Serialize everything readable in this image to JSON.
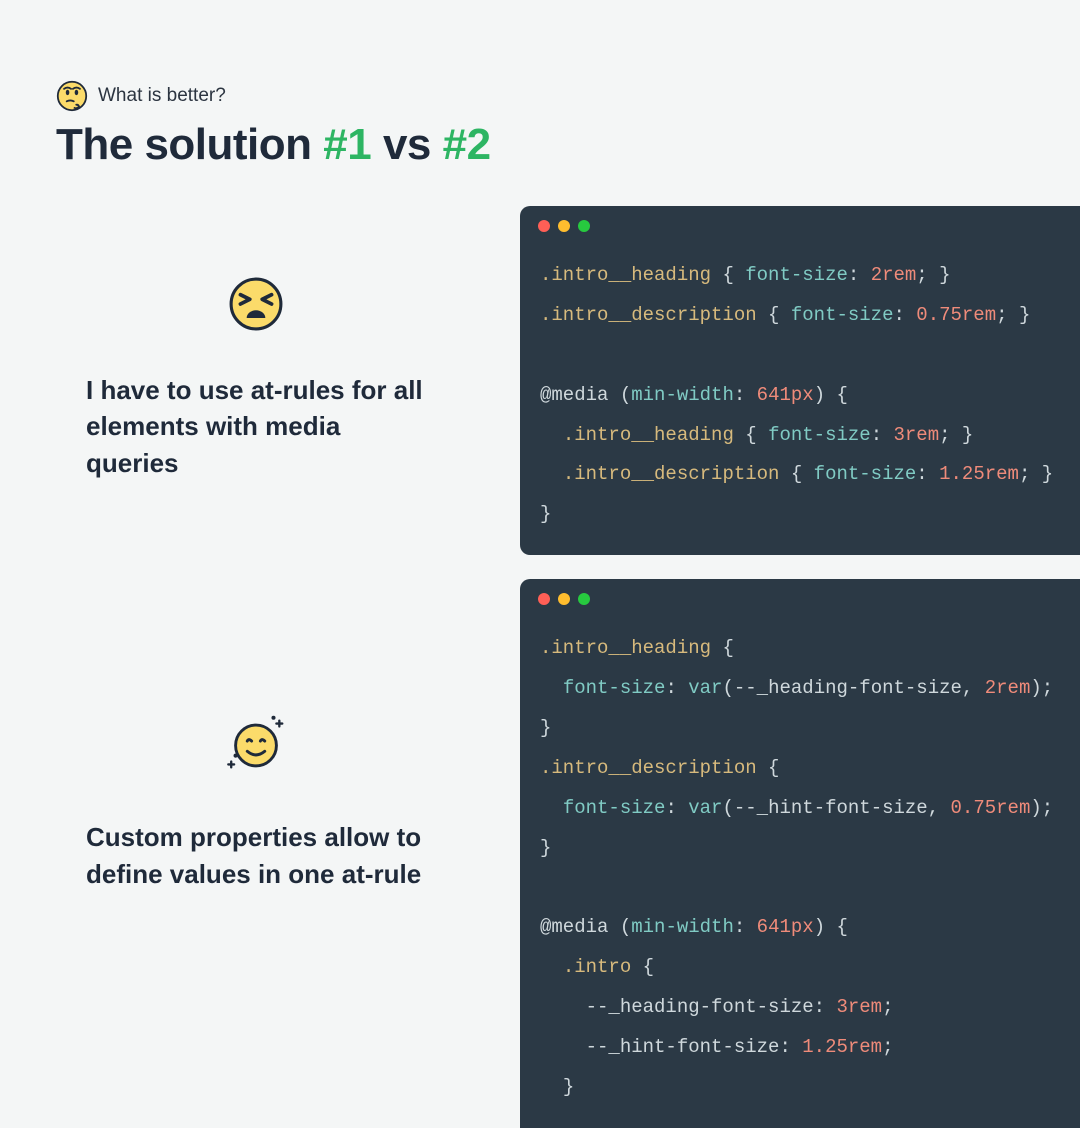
{
  "kicker": "What is better?",
  "title_parts": {
    "a": "The solution ",
    "b": "#1",
    "c": "  vs ",
    "d": "#2"
  },
  "block1": {
    "caption": "I have to use at-rules for all elements with media queries",
    "code": {
      "l1_sel": ".intro__heading",
      "l1_prop": "font-size",
      "l1_val": "2rem",
      "l2_sel": ".intro__description",
      "l2_prop": "font-size",
      "l2_val": "0.75rem",
      "mq_kw": "@media",
      "mq_prop": "min-width",
      "mq_val": "641px",
      "l3_sel": ".intro__heading",
      "l3_prop": "font-size",
      "l3_val": "3rem",
      "l4_sel": ".intro__description",
      "l4_prop": "font-size",
      "l4_val": "1.25rem"
    }
  },
  "block2": {
    "caption": "Custom properties allow to define values in one at-rule",
    "code": {
      "l1_sel": ".intro__heading",
      "l1_prop": "font-size",
      "l1_fn": "var",
      "l1_var": "--_heading-font-size",
      "l1_fallback": "2rem",
      "l2_sel": ".intro__description",
      "l2_prop": "font-size",
      "l2_fn": "var",
      "l2_var": "--_hint-font-size",
      "l2_fallback": "0.75rem",
      "mq_kw": "@media",
      "mq_prop": "min-width",
      "mq_val": "641px",
      "l3_sel": ".intro",
      "l3_var1": "--_heading-font-size",
      "l3_val1": "3rem",
      "l3_var2": "--_hint-font-size",
      "l3_val2": "1.25rem"
    }
  }
}
